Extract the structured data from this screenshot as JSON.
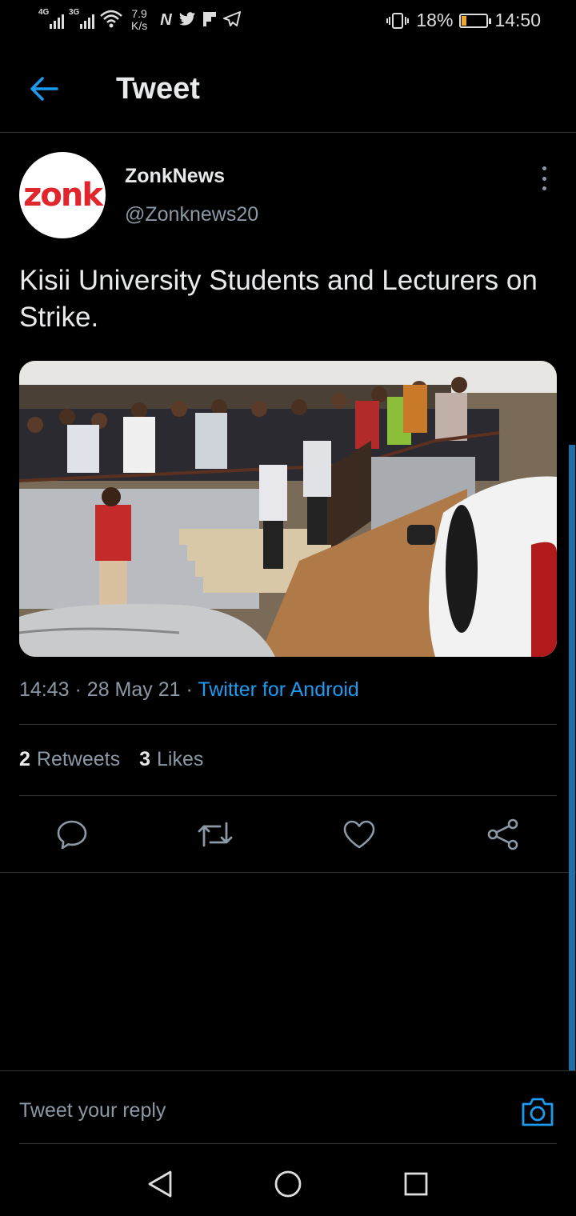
{
  "status_bar": {
    "net1": "4G",
    "net2": "3G",
    "speed_value": "7.9",
    "speed_unit": "K/s",
    "app_icons": [
      "N",
      "twitter-icon",
      "flipboard-icon",
      "telegram-icon"
    ],
    "battery_pct": "18%",
    "battery_level": 0.18,
    "time": "14:50"
  },
  "header": {
    "title": "Tweet"
  },
  "tweet": {
    "author_name": "ZonkNews",
    "author_handle": "@Zonknews20",
    "avatar_text": "zonk",
    "text": "Kisii University Students and Lecturers on Strike.",
    "time": "14:43",
    "date": "28 May 21",
    "source": "Twitter for Android",
    "retweets_count": "2",
    "retweets_label": "Retweets",
    "likes_count": "3",
    "likes_label": "Likes"
  },
  "actions": [
    "reply-icon",
    "retweet-icon",
    "like-icon",
    "share-icon"
  ],
  "reply_bar": {
    "placeholder": "Tweet your reply"
  },
  "colors": {
    "accent": "#1d9bf0",
    "background": "#000000",
    "secondary_text": "#8b98a5",
    "divider": "#2f3336",
    "brand_red": "#e0262c"
  }
}
